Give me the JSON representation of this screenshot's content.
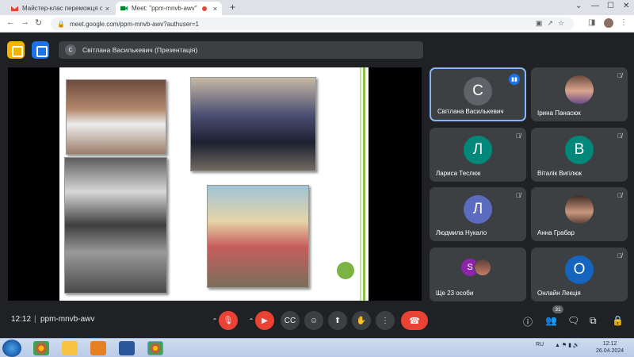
{
  "browser": {
    "tabs": [
      {
        "title": "Майстер-клас переможця обл",
        "favicon": "gmail-icon"
      },
      {
        "title": "Meet: \"ppm-mnvb-awv\"",
        "favicon": "meet-icon",
        "active": true
      }
    ],
    "url": "meet.google.com/ppm-mnvb-awv?authuser=1"
  },
  "meet": {
    "presenter_label": "Світлана Василькевич (Презентація)",
    "presenter_initial": "С",
    "participants": [
      {
        "name": "Світлана Василькевич",
        "initial": "С",
        "avatar_color": "#5f6368",
        "speaking": true
      },
      {
        "name": "Ірина Панасюк",
        "initial": "",
        "avatar_color": "#8d6e63",
        "photo": true
      },
      {
        "name": "Лариса Теслюк",
        "initial": "Л",
        "avatar_color": "#00897b"
      },
      {
        "name": "Віталік Вигілюк",
        "initial": "В",
        "avatar_color": "#00897b"
      },
      {
        "name": "Людмила Нукало",
        "initial": "Л",
        "avatar_color": "#5c6bc0"
      },
      {
        "name": "Анна Грабар",
        "initial": "",
        "avatar_color": "#6d4c41",
        "photo": true
      },
      {
        "name": "Ще 23 особи",
        "initial": "S",
        "avatar_color": "#8e24aa"
      },
      {
        "name": "Онлайн Лекція",
        "initial": "О",
        "avatar_color": "#1565c0"
      }
    ],
    "time": "12:12",
    "separator": "|",
    "meeting_code": "ppm-mnvb-awv",
    "participant_count": "31"
  },
  "taskbar": {
    "lang": "RU",
    "time": "12:12",
    "date": "26.04.2024"
  }
}
